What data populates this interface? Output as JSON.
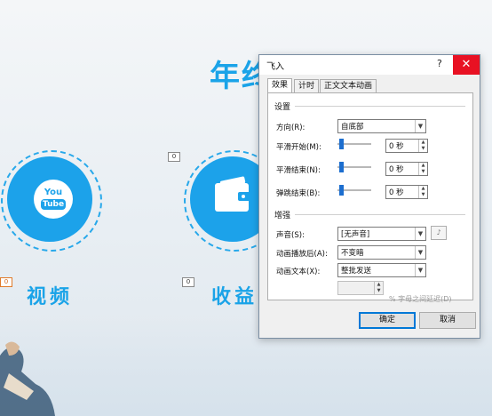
{
  "slide": {
    "title": "年终",
    "items": [
      {
        "label": "视频",
        "box": "0",
        "icon": "youtube-icon",
        "icon_text_top": "You",
        "icon_text_bottom": "Tube"
      },
      {
        "label": "收益",
        "box": "0",
        "icon": "wallet-icon"
      }
    ],
    "side_box": "0"
  },
  "dialog": {
    "title": "飞入",
    "help": "?",
    "close": "✕",
    "tabs": [
      "效果",
      "计时",
      "正文文本动画"
    ],
    "settings_group": "设置",
    "direction_label": "方向(R):",
    "direction_value": "自底部",
    "smooth_start_label": "平滑开始(M):",
    "smooth_start_value": "0 秒",
    "smooth_end_label": "平滑结束(N):",
    "smooth_end_value": "0 秒",
    "bounce_end_label": "弹跳结束(B):",
    "bounce_end_value": "0 秒",
    "enhance_group": "增强",
    "sound_label": "声音(S):",
    "sound_value": "[无声音]",
    "after_anim_label": "动画播放后(A):",
    "after_anim_value": "不变暗",
    "anim_text_label": "动画文本(X):",
    "anim_text_value": "整批发送",
    "delay_note": "% 字母之间延迟(D)",
    "ok": "确定",
    "cancel": "取消"
  },
  "colors": {
    "accent": "#1aa3e8",
    "close": "#e81123",
    "slider": "#1c6ecf"
  }
}
